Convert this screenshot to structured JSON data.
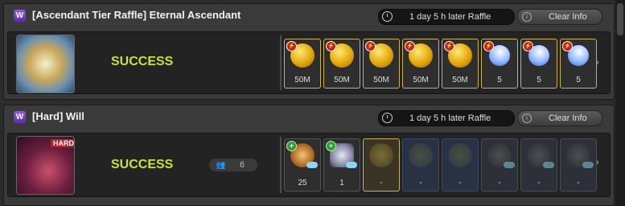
{
  "panels": [
    {
      "badge": "W",
      "title": "[Ascendant Tier Raffle] Eternal Ascendant",
      "raffle_text": "1 day 5 h later Raffle",
      "clear_label": "Clear Info",
      "status": "SUCCESS",
      "rewards": [
        {
          "icon": "meso-coin-icon",
          "count": "50M"
        },
        {
          "icon": "meso-coin-icon",
          "count": "50M"
        },
        {
          "icon": "meso-coin-icon",
          "count": "50M"
        },
        {
          "icon": "meso-coin-icon",
          "count": "50M"
        },
        {
          "icon": "meso-coin-icon",
          "count": "50M"
        },
        {
          "icon": "star-item-icon",
          "count": "5"
        },
        {
          "icon": "star-item-icon",
          "count": "5"
        },
        {
          "icon": "star-item-icon",
          "count": "5"
        }
      ]
    },
    {
      "badge": "W",
      "title": "[Hard] Will",
      "raffle_text": "1 day 5 h later Raffle",
      "clear_label": "Clear Info",
      "status": "SUCCESS",
      "portrait_tag": "HARD",
      "party_count": "6",
      "rewards": [
        {
          "icon": "coin-item-icon",
          "count": "25"
        },
        {
          "icon": "spider-item-icon",
          "count": "1"
        },
        {
          "icon": "locked-gold-slot-icon",
          "count": "-"
        },
        {
          "icon": "locked-blue-slot-icon",
          "count": "-"
        },
        {
          "icon": "locked-blue-slot-icon",
          "count": "-"
        },
        {
          "icon": "locked-grey-slot-icon",
          "count": "-"
        },
        {
          "icon": "locked-grey-slot-icon",
          "count": "-"
        },
        {
          "icon": "locked-grey-slot-icon",
          "count": "-"
        }
      ]
    }
  ],
  "colors": {
    "success": "#c6e33a",
    "badge": "#7a45c4"
  }
}
